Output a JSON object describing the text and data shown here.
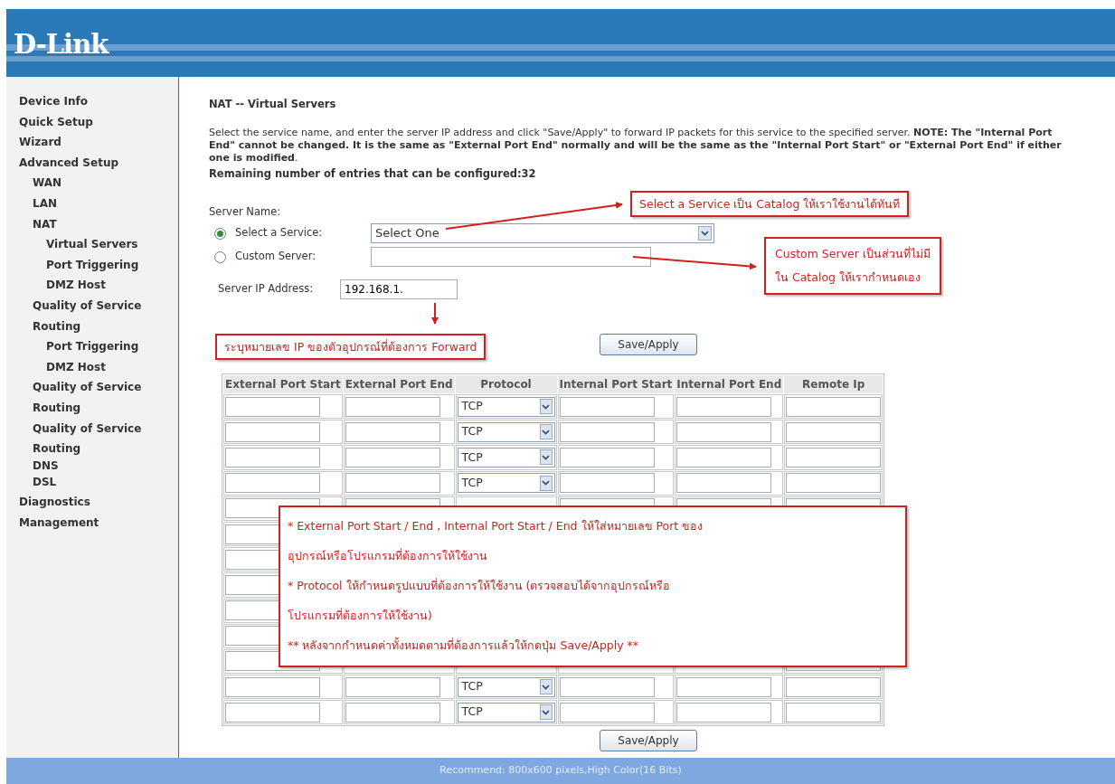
{
  "header": {
    "logo": "D-Link"
  },
  "sidebar": {
    "items": [
      {
        "label": "Device Info"
      },
      {
        "label": "Quick Setup"
      },
      {
        "label": "Wizard"
      },
      {
        "label": "Advanced Setup",
        "children": [
          {
            "label": "WAN"
          },
          {
            "label": "LAN"
          },
          {
            "label": "NAT",
            "children": [
              {
                "label": "Virtual Servers"
              },
              {
                "label": "Port Triggering"
              },
              {
                "label": "DMZ Host"
              }
            ]
          },
          {
            "label": "Quality of Service"
          },
          {
            "label": "Routing",
            "children": [
              {
                "label": "Port Triggering"
              },
              {
                "label": "DMZ Host"
              }
            ]
          },
          {
            "label": "Quality of Service"
          },
          {
            "label": "Routing"
          },
          {
            "label": "Quality of Service"
          },
          {
            "label": "Routing"
          },
          {
            "label": "DNS"
          },
          {
            "label": "DSL"
          }
        ]
      },
      {
        "label": "Diagnostics"
      },
      {
        "label": "Management"
      }
    ]
  },
  "page": {
    "title": "NAT -- Virtual Servers",
    "description": "Select the service name, and enter the server IP address and click \"Save/Apply\" to forward IP packets for this service to the specified server. **NOTE: The \"Internal Port End\" cannot be changed. It is the same as \"External Port End\" normally and will be the same as the \"Internal Port Start\" or \"External Port End\" if either one is modified**.",
    "remaining": "Remaining number of entries that can be configured:32"
  },
  "form": {
    "server_name_label": "Server Name:",
    "options": [
      {
        "kind": "select",
        "label": "Select a Service:",
        "selected": true,
        "value": "Select One"
      },
      {
        "kind": "text",
        "label": "Custom Server:",
        "selected": false
      }
    ],
    "ip_label": "Server IP Address:",
    "ip_value": "192.168.1.",
    "save_button": "Save/Apply"
  },
  "table": {
    "columns": [
      "External Port Start",
      "External Port End",
      "Protocol",
      "Internal Port Start",
      "Internal Port End",
      "Remote Ip"
    ],
    "rows": [
      {
        "protocol": "TCP"
      },
      {
        "protocol": "TCP"
      },
      {
        "protocol": "TCP"
      },
      {
        "protocol": "TCP"
      },
      {
        "protocol": null
      },
      {
        "protocol": null
      },
      {
        "protocol": null
      },
      {
        "protocol": null
      },
      {
        "protocol": null
      },
      {
        "protocol": null
      },
      {
        "protocol": null
      },
      {
        "protocol": "TCP"
      },
      {
        "protocol": "TCP"
      }
    ]
  },
  "save_button": "Save/Apply",
  "footer": "Recommend: 800x600 pixels,High Color(16 Bits)",
  "annotations": [
    {
      "lines": [
        "Select a Service เป็น Catalog ให้เราใช้งานได้ทันที"
      ]
    },
    {
      "lines": [
        "Custom Server เป็นส่วนที่ไม่มี",
        "ใน Catalog ให้เรากำหนดเอง"
      ]
    },
    {
      "lines": [
        "ระบุหมายเลข IP ของตัวอุปกรณ์ที่ต้องการ Forward"
      ]
    },
    {
      "lines": [
        "*  External Port Start / End , Internal Port Start / End ให้ใส่หมายเลข Port ของ",
        "อุปกรณ์หรือโปรแกรมที่ต้องการให้ใช้งาน",
        "*  Protocol ให้กำหนดรูปแบบที่ต้องการให้ใช้งาน (ตรวจสอบได้จากอุปกรณ์หรือ",
        "โปรแกรมที่ต้องการให้ใช้งาน)",
        "**  หลังจากกำหนดค่าทั้งหมดตามที่ต้องการแล้วให้กดปุ่ม Save/Apply  **"
      ]
    }
  ]
}
